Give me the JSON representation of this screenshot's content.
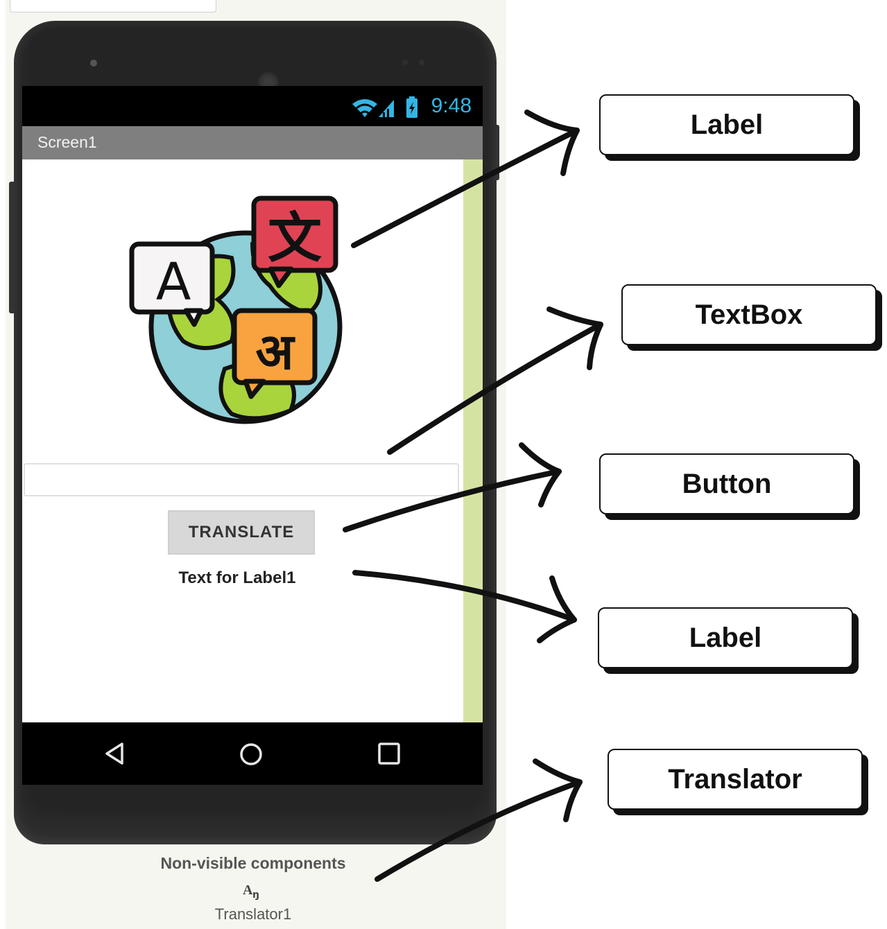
{
  "phone": {
    "status_time": "9:48",
    "screen_title": "Screen1",
    "button_label": "TRANSLATE",
    "label_text": "Text for Label1",
    "textbox_value": ""
  },
  "non_visible": {
    "title": "Non-visible components",
    "component_name": "Translator1"
  },
  "callouts": [
    {
      "label": "Label"
    },
    {
      "label": "TextBox"
    },
    {
      "label": "Button"
    },
    {
      "label": "Label"
    },
    {
      "label": "Translator"
    }
  ],
  "icons": [
    "wifi-icon",
    "signal-icon",
    "battery-icon",
    "back-icon",
    "home-icon",
    "recents-icon",
    "translator-icon",
    "globe-translate-image"
  ],
  "colors": {
    "status_time": "#33b5e5",
    "title_bar": "#7f7f7f",
    "scroll_strip": "#d5e3a2",
    "button_bg": "#d8d8d8"
  }
}
